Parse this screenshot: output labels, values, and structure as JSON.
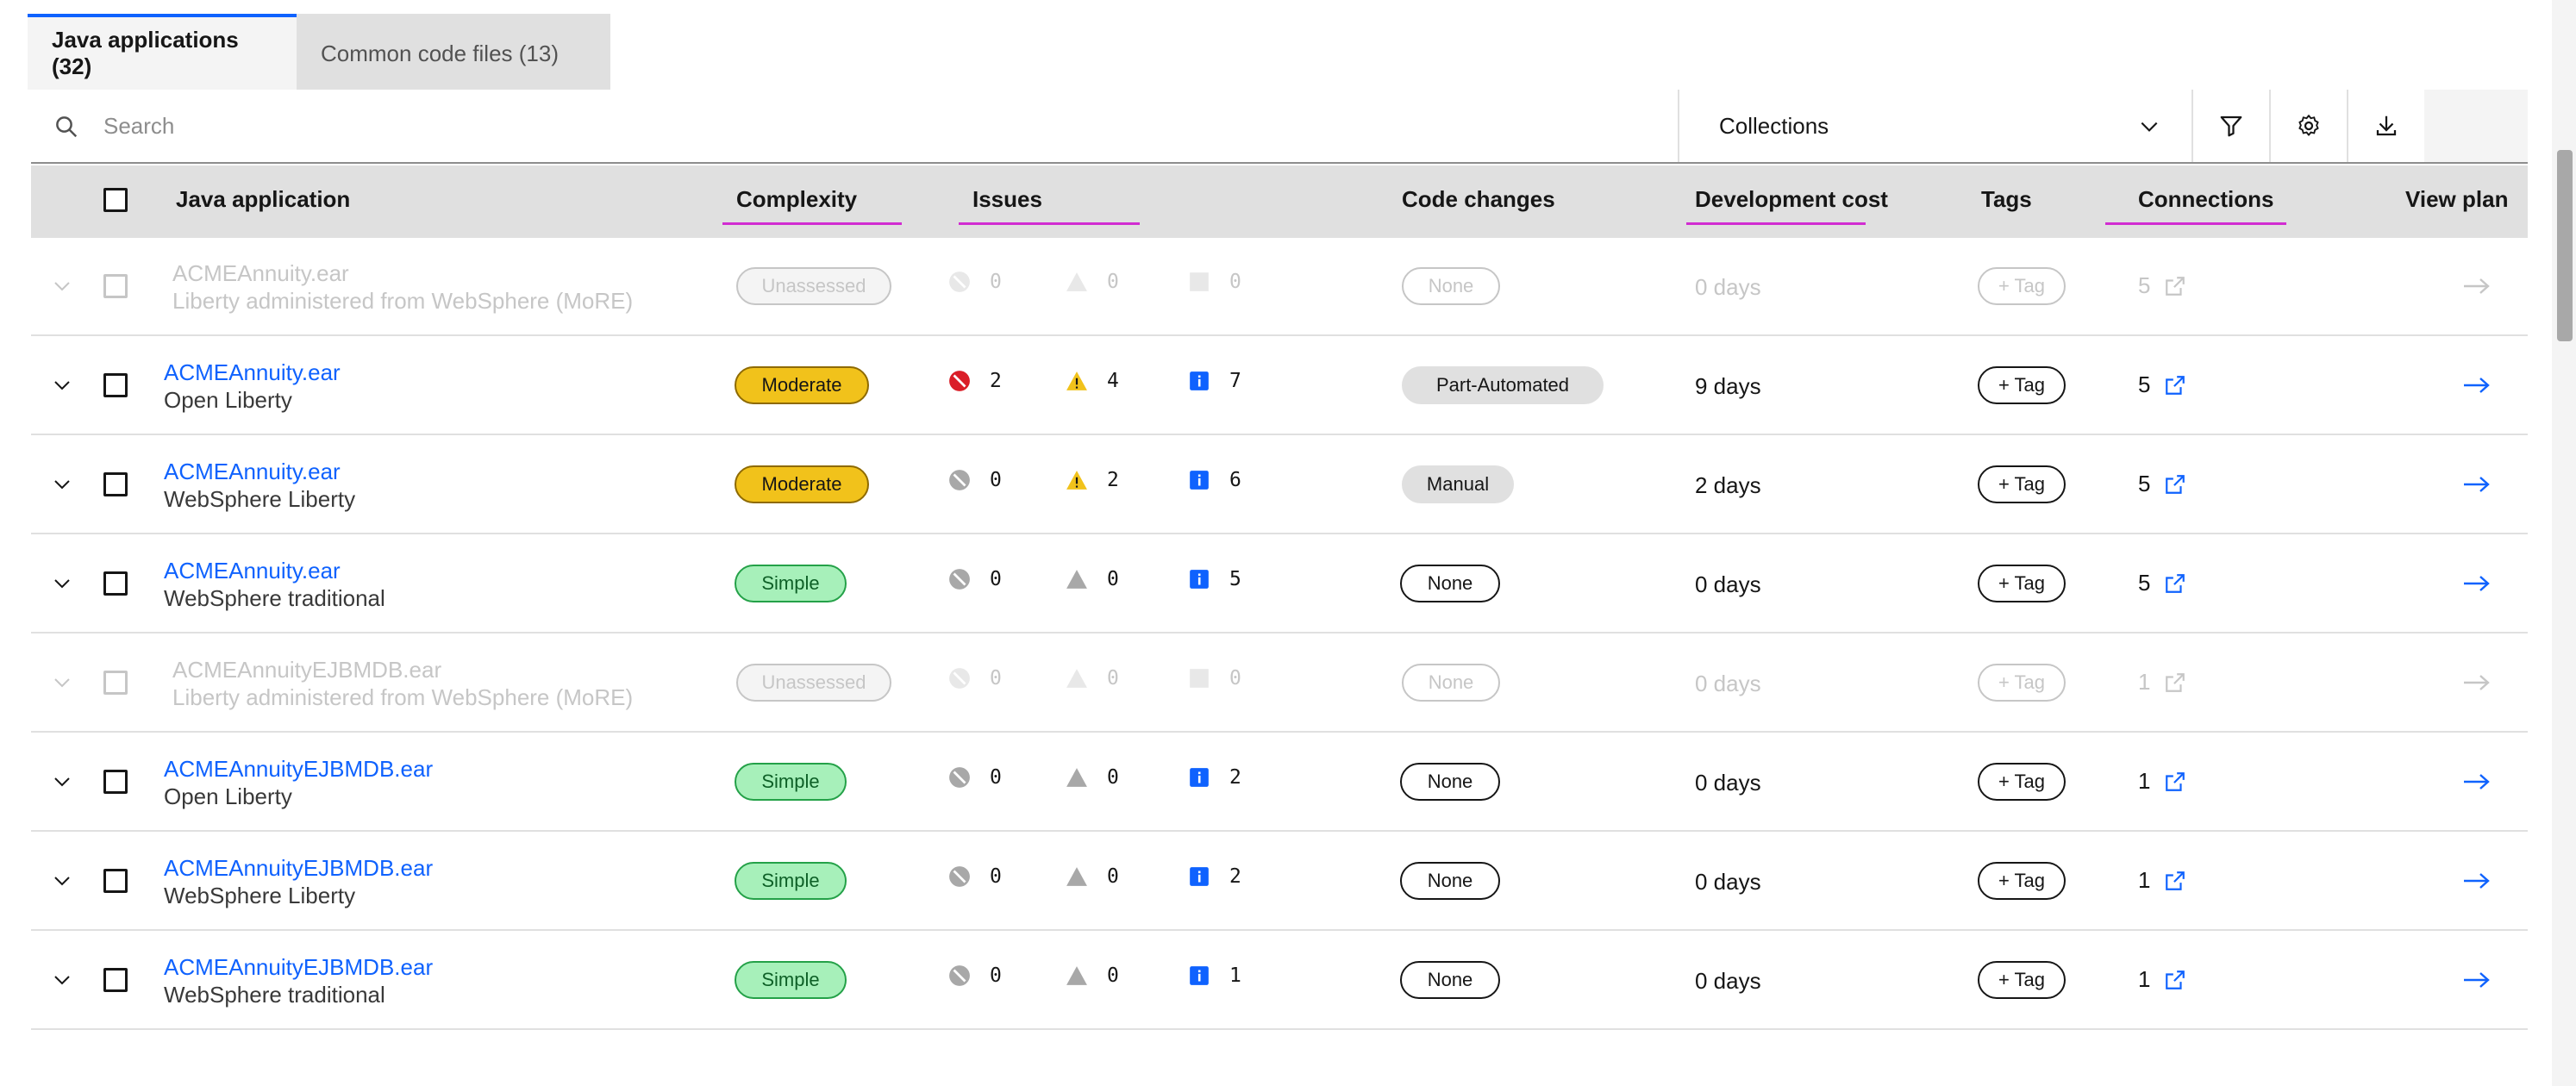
{
  "tabs": {
    "java": "Java applications (32)",
    "common": "Common code files (13)"
  },
  "toolbar": {
    "search_placeholder": "Search",
    "collections": "Collections"
  },
  "columns": {
    "app": "Java application",
    "complexity": "Complexity",
    "issues": "Issues",
    "code_changes": "Code changes",
    "dev_cost": "Development cost",
    "tags": "Tags",
    "connections": "Connections",
    "view_plan": "View plan"
  },
  "rows": [
    {
      "name": "ACMEAnnuity.ear",
      "runtime": "Liberty administered from WebSphere (MoRE)",
      "complexity": "Unassessed",
      "critical": "0",
      "warning": "0",
      "info": "0",
      "code_changes": "None",
      "dev_cost": "0 days",
      "tag": "+ Tag",
      "connections": "5",
      "disabled": true
    },
    {
      "name": "ACMEAnnuity.ear",
      "runtime": "Open Liberty",
      "complexity": "Moderate",
      "critical": "2",
      "warning": "4",
      "info": "7",
      "code_changes": "Part-Automated",
      "dev_cost": "9 days",
      "tag": "+ Tag",
      "connections": "5",
      "disabled": false
    },
    {
      "name": "ACMEAnnuity.ear",
      "runtime": "WebSphere Liberty",
      "complexity": "Moderate",
      "critical": "0",
      "warning": "2",
      "info": "6",
      "code_changes": "Manual",
      "dev_cost": "2 days",
      "tag": "+ Tag",
      "connections": "5",
      "disabled": false
    },
    {
      "name": "ACMEAnnuity.ear",
      "runtime": "WebSphere traditional",
      "complexity": "Simple",
      "critical": "0",
      "warning": "0",
      "info": "5",
      "code_changes": "None",
      "dev_cost": "0 days",
      "tag": "+ Tag",
      "connections": "5",
      "disabled": false
    },
    {
      "name": "ACMEAnnuityEJBMDB.ear",
      "runtime": "Liberty administered from WebSphere (MoRE)",
      "complexity": "Unassessed",
      "critical": "0",
      "warning": "0",
      "info": "0",
      "code_changes": "None",
      "dev_cost": "0 days",
      "tag": "+ Tag",
      "connections": "1",
      "disabled": true
    },
    {
      "name": "ACMEAnnuityEJBMDB.ear",
      "runtime": "Open Liberty",
      "complexity": "Simple",
      "critical": "0",
      "warning": "0",
      "info": "2",
      "code_changes": "None",
      "dev_cost": "0 days",
      "tag": "+ Tag",
      "connections": "1",
      "disabled": false
    },
    {
      "name": "ACMEAnnuityEJBMDB.ear",
      "runtime": "WebSphere Liberty",
      "complexity": "Simple",
      "critical": "0",
      "warning": "0",
      "info": "2",
      "code_changes": "None",
      "dev_cost": "0 days",
      "tag": "+ Tag",
      "connections": "1",
      "disabled": false
    },
    {
      "name": "ACMEAnnuityEJBMDB.ear",
      "runtime": "WebSphere traditional",
      "complexity": "Simple",
      "critical": "0",
      "warning": "0",
      "info": "1",
      "code_changes": "None",
      "dev_cost": "0 days",
      "tag": "+ Tag",
      "connections": "1",
      "disabled": false
    }
  ],
  "colors": {
    "link": "#0f62fe",
    "accent_underline": "#d12cd1",
    "moderate": "#f1c21b",
    "simple": "#a7f0ba",
    "critical": "#da1e28",
    "info": "#0f62fe"
  }
}
